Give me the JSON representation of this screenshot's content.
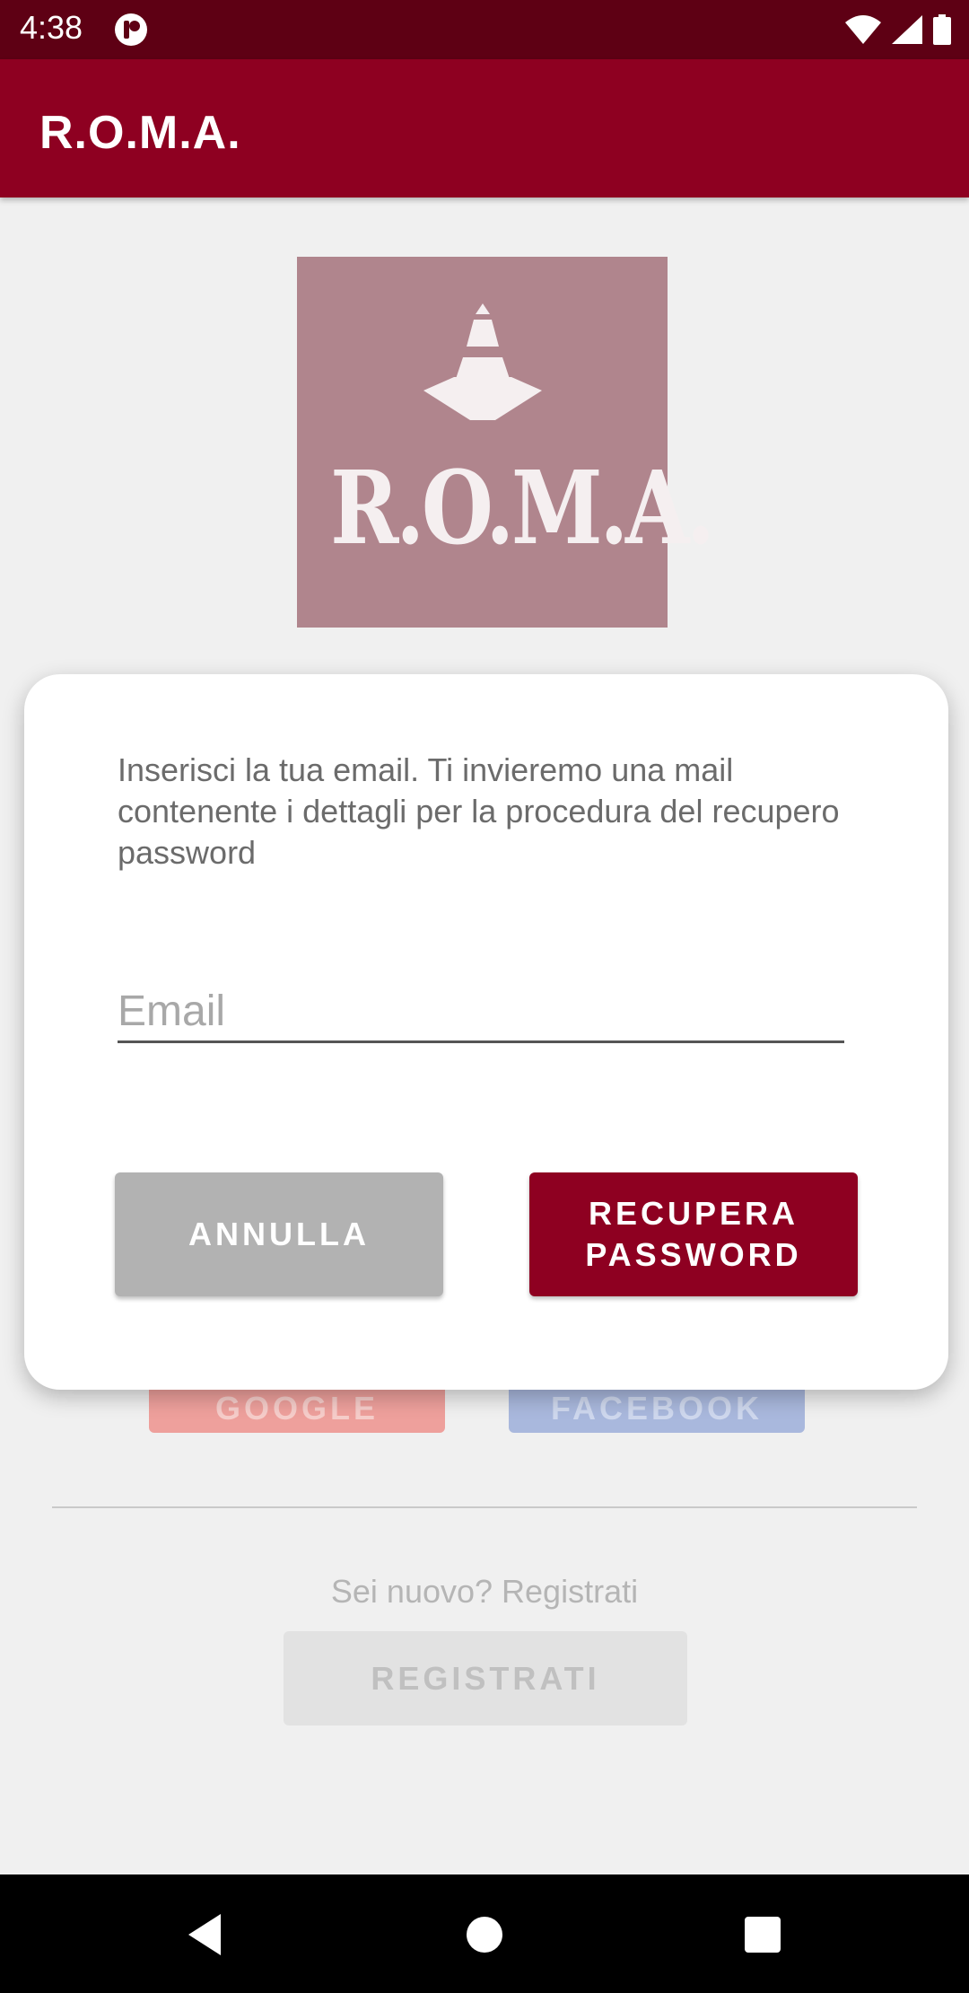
{
  "status_bar": {
    "time": "4:38",
    "icons": [
      "app-notification-icon",
      "wifi-icon",
      "signal-icon",
      "battery-icon"
    ]
  },
  "app_bar": {
    "title": "R.O.M.A."
  },
  "logo": {
    "text": "R.O.M.A.",
    "icon": "traffic-cone-icon"
  },
  "background": {
    "google_label": "GOOGLE",
    "facebook_label": "FACEBOOK",
    "new_user_text": "Sei nuovo? Registrati",
    "register_label": "REGISTRATI"
  },
  "dialog": {
    "message": "Inserisci la tua email. Ti invieremo una mail contenente i dettagli per la procedura del recupero password",
    "email_placeholder": "Email",
    "email_value": "",
    "cancel_label": "ANNULLA",
    "recover_label": "RECUPERA\nPASSWORD"
  },
  "nav_bar": {
    "icons": [
      "back-icon",
      "home-icon",
      "recents-icon"
    ]
  },
  "colors": {
    "status_bar": "#5e0014",
    "primary": "#8e0021",
    "logo_bg": "#b0858d",
    "cancel_button": "#b2b2b2"
  }
}
